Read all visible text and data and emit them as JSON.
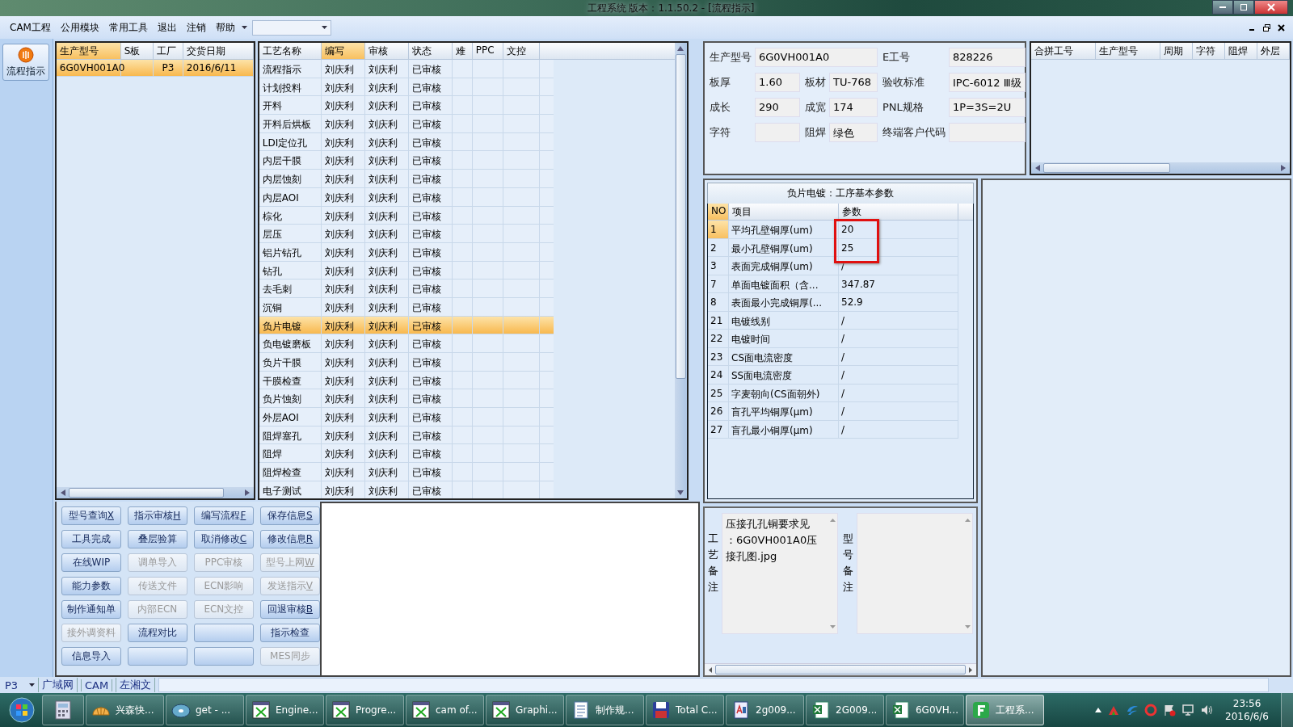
{
  "window": {
    "title": "工程系统    版本：1.1.50.2 - [流程指示]"
  },
  "menu": [
    {
      "label": "CAM工程"
    },
    {
      "label": "公用模块"
    },
    {
      "label": "常用工具"
    },
    {
      "label": "退出"
    },
    {
      "label": "注销"
    },
    {
      "label": "帮助"
    }
  ],
  "side_button": {
    "label": "流程指示"
  },
  "orders": {
    "columns": [
      {
        "label": "生产型号",
        "highlighted": true
      },
      {
        "label": "S板",
        "highlighted": false
      },
      {
        "label": "工厂",
        "highlighted": false
      },
      {
        "label": "交货日期",
        "highlighted": false
      }
    ],
    "rows": [
      {
        "model": "6G0VH001A0",
        "factory": "P3",
        "date": "2016/6/11",
        "selected": true
      }
    ]
  },
  "process": {
    "columns": [
      {
        "label": "工艺名称",
        "highlighted": false
      },
      {
        "label": "编写",
        "highlighted": true
      },
      {
        "label": "审核",
        "highlighted": false
      },
      {
        "label": "状态",
        "highlighted": false
      },
      {
        "label": "难",
        "highlighted": false
      },
      {
        "label": "PPC",
        "highlighted": false
      },
      {
        "label": "文控",
        "highlighted": false
      }
    ],
    "rows": [
      {
        "name": "流程指示",
        "author": "刘庆利",
        "reviewer": "刘庆利",
        "status": "已审核",
        "selected": false
      },
      {
        "name": "计划投料",
        "author": "刘庆利",
        "reviewer": "刘庆利",
        "status": "已审核",
        "selected": false
      },
      {
        "name": "开料",
        "author": "刘庆利",
        "reviewer": "刘庆利",
        "status": "已审核",
        "selected": false
      },
      {
        "name": "开料后烘板",
        "author": "刘庆利",
        "reviewer": "刘庆利",
        "status": "已审核",
        "selected": false
      },
      {
        "name": "LDI定位孔",
        "author": "刘庆利",
        "reviewer": "刘庆利",
        "status": "已审核",
        "selected": false
      },
      {
        "name": "内层干膜",
        "author": "刘庆利",
        "reviewer": "刘庆利",
        "status": "已审核",
        "selected": false
      },
      {
        "name": "内层蚀刻",
        "author": "刘庆利",
        "reviewer": "刘庆利",
        "status": "已审核",
        "selected": false
      },
      {
        "name": "内层AOI",
        "author": "刘庆利",
        "reviewer": "刘庆利",
        "status": "已审核",
        "selected": false
      },
      {
        "name": "棕化",
        "author": "刘庆利",
        "reviewer": "刘庆利",
        "status": "已审核",
        "selected": false
      },
      {
        "name": "层压",
        "author": "刘庆利",
        "reviewer": "刘庆利",
        "status": "已审核",
        "selected": false
      },
      {
        "name": "铝片钻孔",
        "author": "刘庆利",
        "reviewer": "刘庆利",
        "status": "已审核",
        "selected": false
      },
      {
        "name": "钻孔",
        "author": "刘庆利",
        "reviewer": "刘庆利",
        "status": "已审核",
        "selected": false
      },
      {
        "name": "去毛刺",
        "author": "刘庆利",
        "reviewer": "刘庆利",
        "status": "已审核",
        "selected": false
      },
      {
        "name": "沉铜",
        "author": "刘庆利",
        "reviewer": "刘庆利",
        "status": "已审核",
        "selected": false
      },
      {
        "name": "负片电镀",
        "author": "刘庆利",
        "reviewer": "刘庆利",
        "status": "已审核",
        "selected": true
      },
      {
        "name": "负电镀磨板",
        "author": "刘庆利",
        "reviewer": "刘庆利",
        "status": "已审核",
        "selected": false
      },
      {
        "name": "负片干膜",
        "author": "刘庆利",
        "reviewer": "刘庆利",
        "status": "已审核",
        "selected": false
      },
      {
        "name": "干膜检查",
        "author": "刘庆利",
        "reviewer": "刘庆利",
        "status": "已审核",
        "selected": false
      },
      {
        "name": "负片蚀刻",
        "author": "刘庆利",
        "reviewer": "刘庆利",
        "status": "已审核",
        "selected": false
      },
      {
        "name": "外层AOI",
        "author": "刘庆利",
        "reviewer": "刘庆利",
        "status": "已审核",
        "selected": false
      },
      {
        "name": "阻焊塞孔",
        "author": "刘庆利",
        "reviewer": "刘庆利",
        "status": "已审核",
        "selected": false
      },
      {
        "name": "阻焊",
        "author": "刘庆利",
        "reviewer": "刘庆利",
        "status": "已审核",
        "selected": false
      },
      {
        "name": "阻焊检查",
        "author": "刘庆利",
        "reviewer": "刘庆利",
        "status": "已审核",
        "selected": false
      },
      {
        "name": "电子测试",
        "author": "刘庆利",
        "reviewer": "刘庆利",
        "status": "已审核",
        "selected": false
      }
    ]
  },
  "actions": [
    {
      "label": "型号查询",
      "shortcut": "X",
      "disabled": false
    },
    {
      "label": "指示审核",
      "shortcut": "H",
      "disabled": false
    },
    {
      "label": "编写流程",
      "shortcut": "F",
      "disabled": false
    },
    {
      "label": "保存信息",
      "shortcut": "S",
      "disabled": false
    },
    {
      "label": "工具完成",
      "disabled": false
    },
    {
      "label": "叠层验算",
      "disabled": false
    },
    {
      "label": "取消修改",
      "shortcut": "C",
      "disabled": false
    },
    {
      "label": "修改信息",
      "shortcut": "R",
      "disabled": false
    },
    {
      "label": "在线WIP",
      "disabled": false
    },
    {
      "label": "调单导入",
      "disabled": true
    },
    {
      "label": "PPC审核",
      "disabled": true
    },
    {
      "label": "型号上网",
      "shortcut": "W",
      "disabled": true
    },
    {
      "label": "能力参数",
      "disabled": false
    },
    {
      "label": "传送文件",
      "disabled": true
    },
    {
      "label": "ECN影响",
      "disabled": true
    },
    {
      "label": "发送指示",
      "shortcut": "V",
      "disabled": true
    },
    {
      "label": "制作通知单",
      "disabled": false
    },
    {
      "label": "内部ECN",
      "disabled": true
    },
    {
      "label": "ECN文控",
      "disabled": true
    },
    {
      "label": "回退审核",
      "shortcut": "B",
      "disabled": false
    },
    {
      "label": "接外调资料",
      "disabled": true
    },
    {
      "label": "流程对比",
      "disabled": false
    },
    {
      "disabled": false
    },
    {
      "label": "指示检查",
      "disabled": false
    },
    {
      "label": "信息导入",
      "disabled": false
    },
    {
      "disabled": false
    },
    {
      "disabled": false
    },
    {
      "label": "MES同步",
      "disabled": true
    }
  ],
  "info": {
    "fields": [
      {
        "label": "生产型号",
        "value": "6G0VH001A0"
      },
      {
        "label": "E工号",
        "value": "828226"
      },
      {
        "label": "板厚",
        "value": "1.60"
      },
      {
        "label": "板材",
        "value": "TU-768"
      },
      {
        "label": "验收标准",
        "value": "IPC-6012 Ⅲ级"
      },
      {
        "label": "成长",
        "value": "290"
      },
      {
        "label": "成宽",
        "value": "174"
      },
      {
        "label": "PNL规格",
        "value": "1P=3S=2U"
      },
      {
        "label": "字符"
      },
      {
        "label": "阻焊",
        "value": "绿色"
      },
      {
        "label": "终端客户代码"
      }
    ]
  },
  "merge_table": {
    "columns": [
      "合拼工号",
      "生产型号",
      "周期",
      "字符",
      "阻焊",
      "外层"
    ]
  },
  "params": {
    "title": "负片电镀：工序基本参数",
    "columns": [
      {
        "label": "NO",
        "highlighted": true
      },
      {
        "label": "项目",
        "highlighted": false
      },
      {
        "label": "参数",
        "highlighted": false
      }
    ],
    "rows": [
      {
        "no": "1",
        "item": "平均孔壁铜厚(um)",
        "value": "20",
        "current": true,
        "marked": true
      },
      {
        "no": "2",
        "item": "最小孔壁铜厚(um)",
        "value": "25",
        "current": false,
        "marked": true
      },
      {
        "no": "3",
        "item": "表面完成铜厚(um)",
        "value": "/",
        "current": false,
        "marked": false
      },
      {
        "no": "7",
        "item": "单面电镀面积（含...",
        "value": "347.87",
        "current": false,
        "marked": false
      },
      {
        "no": "8",
        "item": "表面最小完成铜厚(...",
        "value": "52.9",
        "current": false,
        "marked": false
      },
      {
        "no": "21",
        "item": "电镀线别",
        "value": "/",
        "current": false,
        "marked": false
      },
      {
        "no": "22",
        "item": "电镀时间",
        "value": "/",
        "current": false,
        "marked": false
      },
      {
        "no": "23",
        "item": "CS面电流密度",
        "value": "/",
        "current": false,
        "marked": false
      },
      {
        "no": "24",
        "item": "SS面电流密度",
        "value": "/",
        "current": false,
        "marked": false
      },
      {
        "no": "25",
        "item": "字麦朝向(CS面朝外)",
        "value": "/",
        "current": false,
        "marked": false
      },
      {
        "no": "26",
        "item": "盲孔平均铜厚(μm)",
        "value": "/",
        "current": false,
        "marked": false
      },
      {
        "no": "27",
        "item": "盲孔最小铜厚(μm)",
        "value": "/",
        "current": false,
        "marked": false
      }
    ]
  },
  "remarks": [
    {
      "label": "工艺备注",
      "lines": [
        "压接孔孔铜要求见",
        "：6G0VH001A0压",
        "接孔图.jpg"
      ]
    },
    {
      "label": "型号备注"
    }
  ],
  "status_bar": {
    "factory": "P3",
    "tabs": [
      "广域网",
      "CAM",
      "左湘文"
    ]
  },
  "taskbar": {
    "items": [
      {
        "kind": "calc",
        "selected": false
      },
      {
        "kind": "shell",
        "label": "兴森快...",
        "selected": false
      },
      {
        "kind": "disc",
        "label": "get - ...",
        "selected": false
      },
      {
        "kind": "xwin",
        "label": "Engine...",
        "selected": false
      },
      {
        "kind": "xwin",
        "label": "Progre...",
        "selected": false
      },
      {
        "kind": "xwin",
        "label": "cam of...",
        "selected": false
      },
      {
        "kind": "xwin",
        "label": "Graphi...",
        "selected": false
      },
      {
        "kind": "doc",
        "label": "制作规...",
        "selected": false
      },
      {
        "kind": "disk",
        "label": "Total C...",
        "selected": false
      },
      {
        "kind": "word",
        "label": "2g009...",
        "selected": false
      },
      {
        "kind": "sheet",
        "label": "2G009...",
        "selected": false
      },
      {
        "kind": "sheet",
        "label": "6G0VH...",
        "selected": false
      },
      {
        "kind": "app",
        "label": "工程系...",
        "selected": true
      }
    ],
    "time": "23:56",
    "date": "2016/6/6"
  }
}
